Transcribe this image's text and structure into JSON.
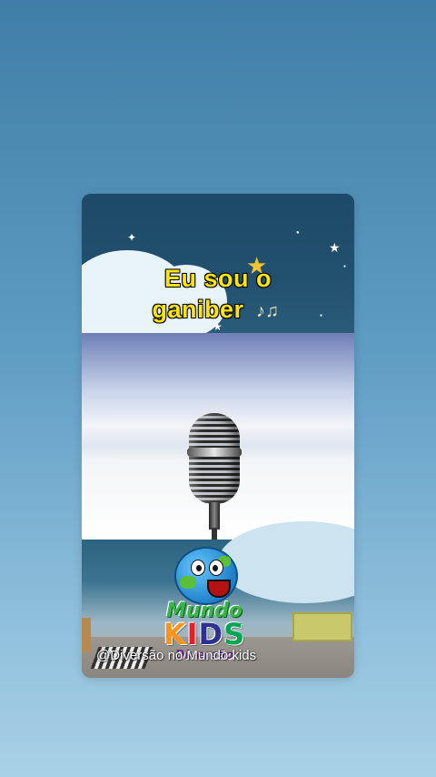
{
  "video": {
    "lyric_line1": "Eu sou o",
    "lyric_line2": "ganiber",
    "music_notes": "♪♫",
    "watermark": "@Diversão no Mundo kids"
  },
  "logo": {
    "word_top": "Mundo",
    "word_main": [
      "K",
      "I",
      "D",
      "S"
    ],
    "word_bottom": "Diversão"
  },
  "colors": {
    "lyric": "#ffe600",
    "background_top": "#3f7ea6",
    "background_bottom": "#a9d0e6"
  }
}
